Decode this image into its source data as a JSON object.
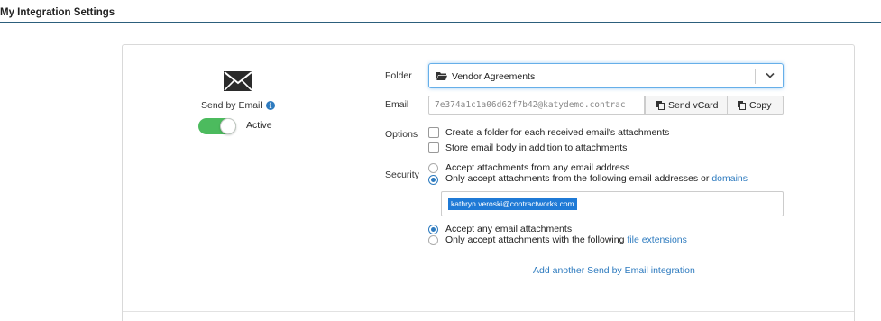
{
  "page": {
    "title": "My Integration Settings"
  },
  "integration": {
    "icon": "envelope-icon",
    "name": "Send by Email",
    "info_icon_glyph": "i",
    "status": "Active",
    "enabled": true
  },
  "form": {
    "folder": {
      "label": "Folder",
      "value": "Vendor Agreements"
    },
    "email": {
      "label": "Email",
      "value": "7e374a1c1a06d62f7b42@katydemo.contrac",
      "send_vcard_label": "Send vCard",
      "copy_label": "Copy"
    },
    "options": {
      "label": "Options",
      "items": [
        {
          "label": "Create a folder for each received email's attachments",
          "checked": false
        },
        {
          "label": "Store email body in addition to attachments",
          "checked": false
        }
      ]
    },
    "security": {
      "label": "Security",
      "sender_options": [
        {
          "label": "Accept attachments from any email address",
          "selected": false
        },
        {
          "label": "Only accept attachments from the following email addresses or",
          "link": "domains",
          "selected": true
        }
      ],
      "allowed_addresses": [
        "kathryn.veroski@contractworks.com"
      ],
      "attachment_options": [
        {
          "label": "Accept any email attachments",
          "selected": true
        },
        {
          "label": "Only accept attachments with the following",
          "link": "file extensions",
          "selected": false
        }
      ]
    },
    "add_integration_label": "Add another Send by Email integration"
  },
  "colors": {
    "accent": "#2e7bbf",
    "toggle_on": "#4cbb5e",
    "tag_bg": "#1f7ad6",
    "title_rule": "#2c5f7c"
  }
}
